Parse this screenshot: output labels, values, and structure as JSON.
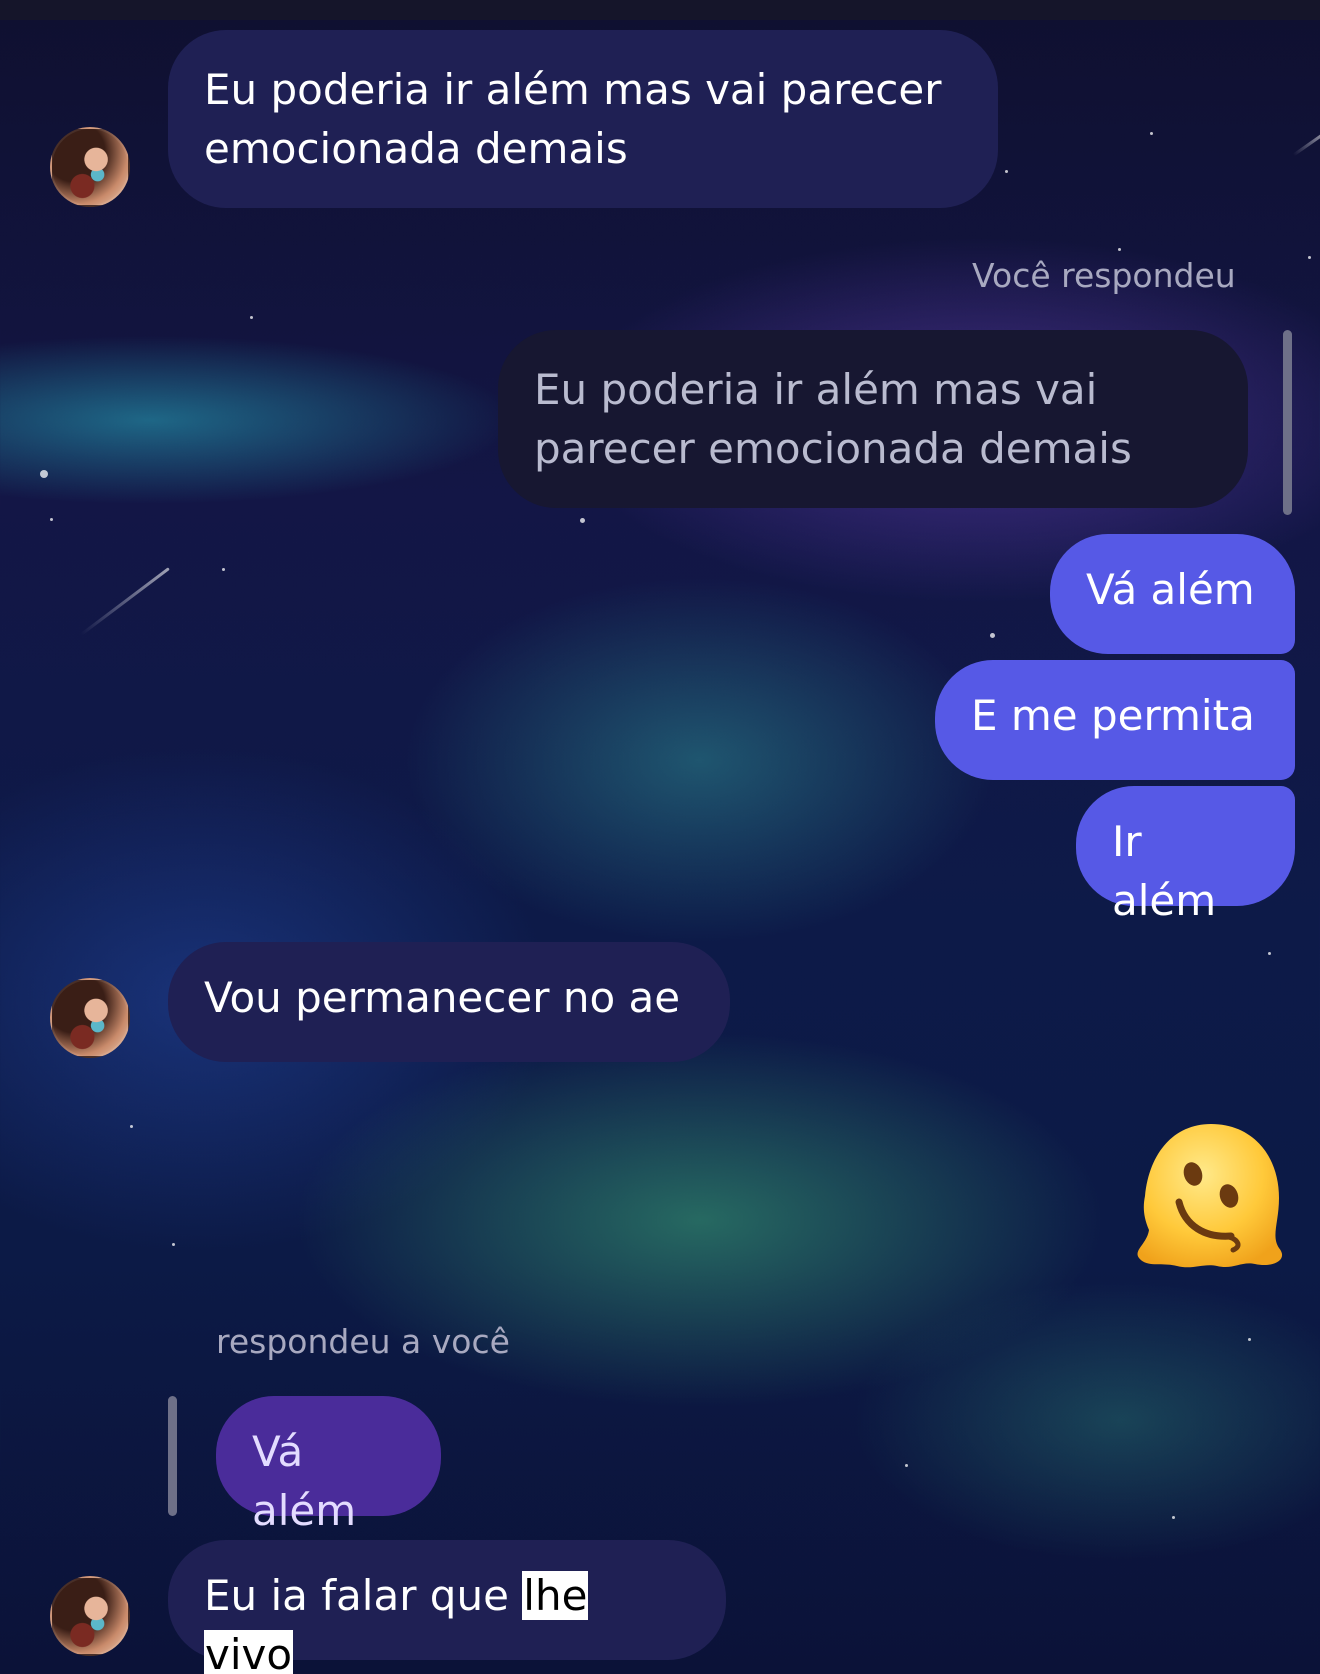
{
  "messages": {
    "m1": {
      "text": "Eu poderia ir além mas vai parecer emocionada demais"
    },
    "reply_label_you": "Você respondeu",
    "quoted_you": "Eu poderia ir além mas vai parecer emocionada demais",
    "out1": "Vá além",
    "out2": "E me permita",
    "out3": "Ir além",
    "m2": "Vou permanecer no ae",
    "reply_label_them": "respondeu a você",
    "quoted_them": "Vá além",
    "m3": {
      "part1": "Eu ia falar que ",
      "hl1": "lhe",
      "space": " ",
      "hl2": "vivo"
    }
  },
  "sticker": {
    "name": "melting-face-emoji"
  },
  "colors": {
    "incoming": "#1f2054",
    "outgoing": "#5659e6",
    "quoted": "#171731",
    "reply": "#4a2c9a"
  }
}
